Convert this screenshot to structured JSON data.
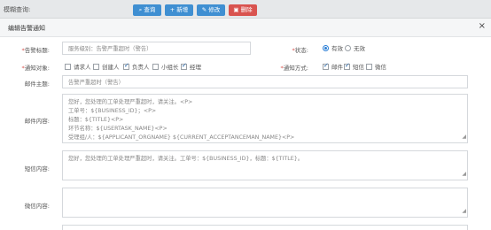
{
  "toolbar": {
    "fuzzy_label": "模糊查询:",
    "buttons": {
      "query": "查询",
      "add": "新增",
      "edit": "修改",
      "delete": "删除"
    }
  },
  "dialog": {
    "title": "编辑告警通知"
  },
  "form": {
    "alert_title": {
      "label": "*告警标题:",
      "value": "服务级别：告警严重超时（警告）"
    },
    "status": {
      "label": "*状态:",
      "options": [
        "有效",
        "无效"
      ],
      "selected": "有效"
    },
    "notify_target": {
      "label": "*通知对象:",
      "options": [
        {
          "text": "请求人",
          "checked": false
        },
        {
          "text": "创建人",
          "checked": false
        },
        {
          "text": "负责人",
          "checked": true
        },
        {
          "text": "小组长",
          "checked": false
        },
        {
          "text": "经理",
          "checked": true
        }
      ]
    },
    "notify_method": {
      "label": "*通知方式:",
      "options": [
        {
          "text": "邮件",
          "checked": true
        },
        {
          "text": "短信",
          "checked": true
        },
        {
          "text": "微信",
          "checked": false
        }
      ]
    },
    "email_subject": {
      "label": "邮件主题:",
      "value": "告警严重超时（警告）"
    },
    "email_content": {
      "label": "邮件内容:",
      "lines": [
        "您好，您处理的工单处理严重超时，请关注。<P>",
        "工单号：${BUSINESS_ID}；<P>",
        "标题：${TITLE}<P>",
        "环节名称：${USERTASK_NAME}<P>",
        "受理组/人：${APPLICANT_ORGNAME} ${CURRENT_ACCEPTANCEMAN_NAME}<P>"
      ]
    },
    "sms_content": {
      "label": "短信内容:",
      "value": "您好，您处理的工单处理严重超时，请关注。工单号：${BUSINESS_ID}，标题：${TITLE}。"
    },
    "wechat_content": {
      "label": "微信内容:",
      "value": ""
    }
  }
}
